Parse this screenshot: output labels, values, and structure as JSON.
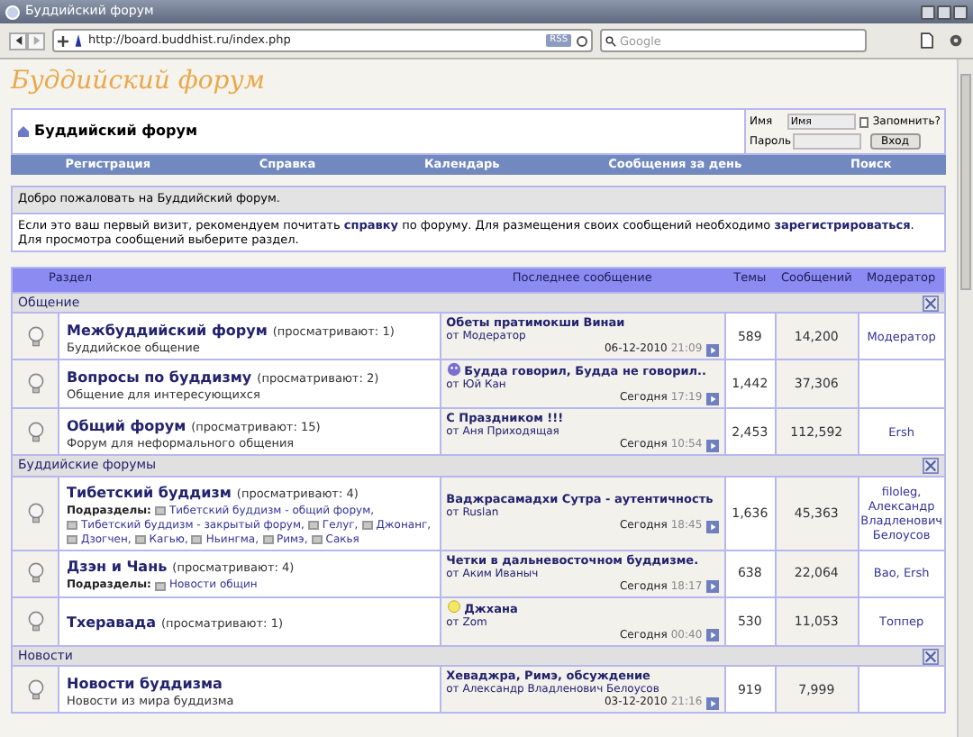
{
  "browser": {
    "title": "Буддийский форум",
    "url": "http://board.buddhist.ru/index.php",
    "rss": "RSS",
    "search_placeholder": "Google"
  },
  "forum": {
    "logo": "Буддийский форум",
    "header_title": "Буддийский форум",
    "login": {
      "name_label": "Имя",
      "name_value": "Имя",
      "remember_label": "Запомнить?",
      "remember_checked": false,
      "password_label": "Пароль",
      "button": "Вход"
    },
    "nav": [
      "Регистрация",
      "Справка",
      "Календарь",
      "Сообщения за день",
      "Поиск"
    ],
    "welcome": {
      "title": "Добро пожаловать на Буддийский форум.",
      "text_1": "Если это ваш первый визит, рекомендуем почитать",
      "link_1": "справку",
      "text_2": "по форуму. Для размещения своих сообщений необходимо",
      "link_2": "зарегистрироваться",
      "text_3": ". Для просмотра сообщений выберите раздел."
    },
    "columns": [
      "Раздел",
      "Последнее сообщение",
      "Темы",
      "Сообщений",
      "Модератор"
    ],
    "categories": [
      {
        "name": "Общение",
        "forums": [
          {
            "title": "Межбуддийский форум",
            "viewers": "(просматривают: 1)",
            "description": "Буддийское общение",
            "last_post": {
              "title": "Обеты пратимокши Винаи",
              "author": "от Модератор",
              "date": "06-12-2010",
              "time": "21:09"
            },
            "topics": "589",
            "posts": "14,200",
            "moderator": "Модератор"
          },
          {
            "title": "Вопросы по буддизму",
            "viewers": "(просматривают: 2)",
            "description": "Общение для интересующихся",
            "last_post": {
              "kind": "smiley",
              "title": "Будда говорил, Будда не говорил..",
              "author": "от Юй Кан",
              "date": "Сегодня",
              "time": "17:19"
            },
            "topics": "1,442",
            "posts": "37,306"
          },
          {
            "title": "Общий форум",
            "viewers": "(просматривают: 15)",
            "description": "Форум для неформального общения",
            "last_post": {
              "title": "С Праздником !!!",
              "author": "от Аня Приходящая",
              "date": "Сегодня",
              "time": "10:54"
            },
            "topics": "2,453",
            "posts": "112,592",
            "moderator": "Ersh"
          }
        ]
      },
      {
        "name": "Буддийские форумы",
        "forums": [
          {
            "title": "Тибетский буддизм",
            "viewers": "(просматривают: 4)",
            "subforums_label": "Подразделы:",
            "subforums": [
              "Тибетский буддизм - общий форум,",
              "Тибетский буддизм - закрытый форум,",
              "Гелуг,",
              "Джонанг,",
              "Дзогчен,",
              "Кагью,",
              "Ньингма,",
              "Римэ,",
              "Сакья"
            ],
            "last_post": {
              "title": "Ваджрасамадхи Сутра - аутентичность",
              "author": "от Ruslan",
              "date": "Сегодня",
              "time": "18:45"
            },
            "topics": "1,636",
            "posts": "45,363",
            "moderator": "filoleg, Александр Владленович Белоусов"
          },
          {
            "title": "Дзэн и Чань",
            "viewers": "(просматривают: 4)",
            "subforums_label": "Подразделы:",
            "subforums": [
              "Новости общин"
            ],
            "last_post": {
              "title": "Четки в дальневосточном буддизме.",
              "author": "от Аким Иваныч",
              "date": "Сегодня",
              "time": "18:17"
            },
            "topics": "638",
            "posts": "22,064",
            "moderator": "Bao, Ersh"
          },
          {
            "title": "Тхеравада",
            "viewers": "(просматривают: 1)",
            "last_post": {
              "kind": "bulb",
              "title": "Джхана",
              "author": "от Zom",
              "date": "Сегодня",
              "time": "00:40"
            },
            "topics": "530",
            "posts": "11,053",
            "moderator": "Топпер"
          }
        ]
      },
      {
        "name": "Новости",
        "forums": [
          {
            "title": "Новости буддизма",
            "description": "Новости из мира буддизма",
            "last_post": {
              "title": "Хеваджра, Римэ, обсуждение",
              "author": "от Александр Владленович Белоусов",
              "date": "03-12-2010",
              "time": "21:16"
            },
            "topics": "919",
            "posts": "7,999"
          }
        ]
      }
    ]
  }
}
